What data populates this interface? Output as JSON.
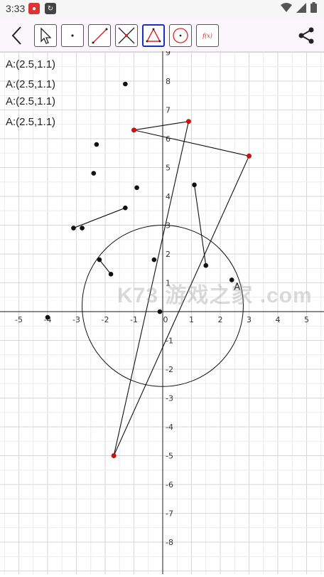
{
  "status_bar": {
    "time": "3:33",
    "icons": [
      "app-badge-icon",
      "sync-icon",
      "wifi-icon",
      "signal-icon",
      "battery-icon"
    ]
  },
  "toolbar": {
    "tools": [
      {
        "name": "select-tool",
        "icon": "cursor-arrow-icon",
        "selected": false
      },
      {
        "name": "point-tool",
        "icon": "dot-icon",
        "selected": false
      },
      {
        "name": "segment-tool",
        "icon": "segment-icon",
        "selected": false
      },
      {
        "name": "intersection-tool",
        "icon": "intersect-lines-icon",
        "selected": false
      },
      {
        "name": "polygon-tool",
        "icon": "triangle-icon",
        "selected": true
      },
      {
        "name": "circle-tool",
        "icon": "circle-icon",
        "selected": false
      },
      {
        "name": "function-tool",
        "icon": "function-icon",
        "selected": false
      }
    ],
    "function_tool_label": "f(x)"
  },
  "coordinate_labels": [
    "A:(2.5,1.1)",
    "A:(2.5,1.1)",
    "A:(2.5,1.1)",
    "A:(2.5,1.1)"
  ],
  "watermark": "K73 游戏之家 .com",
  "point_label": "A",
  "colors": {
    "selected_border": "#1730c8",
    "red_point": "#cc1111",
    "grid": "#dddddd"
  },
  "axes": {
    "x_ticks": [
      "-5",
      "-4",
      "-3",
      "-2",
      "-1",
      "0",
      "1",
      "2",
      "3",
      "4",
      "5"
    ],
    "y_ticks": [
      "9",
      "8",
      "7",
      "6",
      "5",
      "4",
      "3",
      "2",
      "1",
      "-1",
      "-2",
      "-3",
      "-4",
      "-5",
      "-6",
      "-7",
      "-8"
    ],
    "xlim": [
      -5.6,
      5.6
    ],
    "ylim": [
      -8.9,
      9.3
    ]
  },
  "geometry": {
    "black_points": [
      [
        -1.3,
        7.9
      ],
      [
        -2.3,
        5.8
      ],
      [
        -2.4,
        4.8
      ],
      [
        -0.9,
        4.3
      ],
      [
        -1.3,
        3.6
      ],
      [
        -3.1,
        2.9
      ],
      [
        -2.8,
        2.9
      ],
      [
        -2.2,
        1.8
      ],
      [
        -1.8,
        1.3
      ],
      [
        -0.3,
        1.8
      ],
      [
        -0.1,
        0.0
      ],
      [
        1.1,
        4.4
      ],
      [
        1.5,
        1.6
      ],
      [
        2.4,
        1.1
      ],
      [
        -4.0,
        -0.2
      ]
    ],
    "red_points": [
      [
        -1.0,
        6.3
      ],
      [
        0.9,
        6.6
      ],
      [
        3.0,
        5.4
      ],
      [
        -1.7,
        -5.0
      ]
    ],
    "segments": [
      [
        [
          -3.1,
          2.9
        ],
        [
          -1.3,
          3.6
        ]
      ],
      [
        [
          -2.2,
          1.8
        ],
        [
          -1.8,
          1.3
        ]
      ],
      [
        [
          1.1,
          4.4
        ],
        [
          1.5,
          1.6
        ]
      ],
      [
        [
          -1.0,
          6.3
        ],
        [
          0.9,
          6.6
        ]
      ],
      [
        [
          -1.0,
          6.3
        ],
        [
          3.0,
          5.4
        ]
      ],
      [
        [
          0.9,
          6.6
        ],
        [
          -1.7,
          -5.0
        ]
      ],
      [
        [
          3.0,
          5.4
        ],
        [
          -1.7,
          -5.0
        ]
      ]
    ],
    "circle": {
      "center": [
        0.0,
        0.2
      ],
      "radius": 2.8
    },
    "label_point": [
      2.4,
      1.1
    ]
  }
}
